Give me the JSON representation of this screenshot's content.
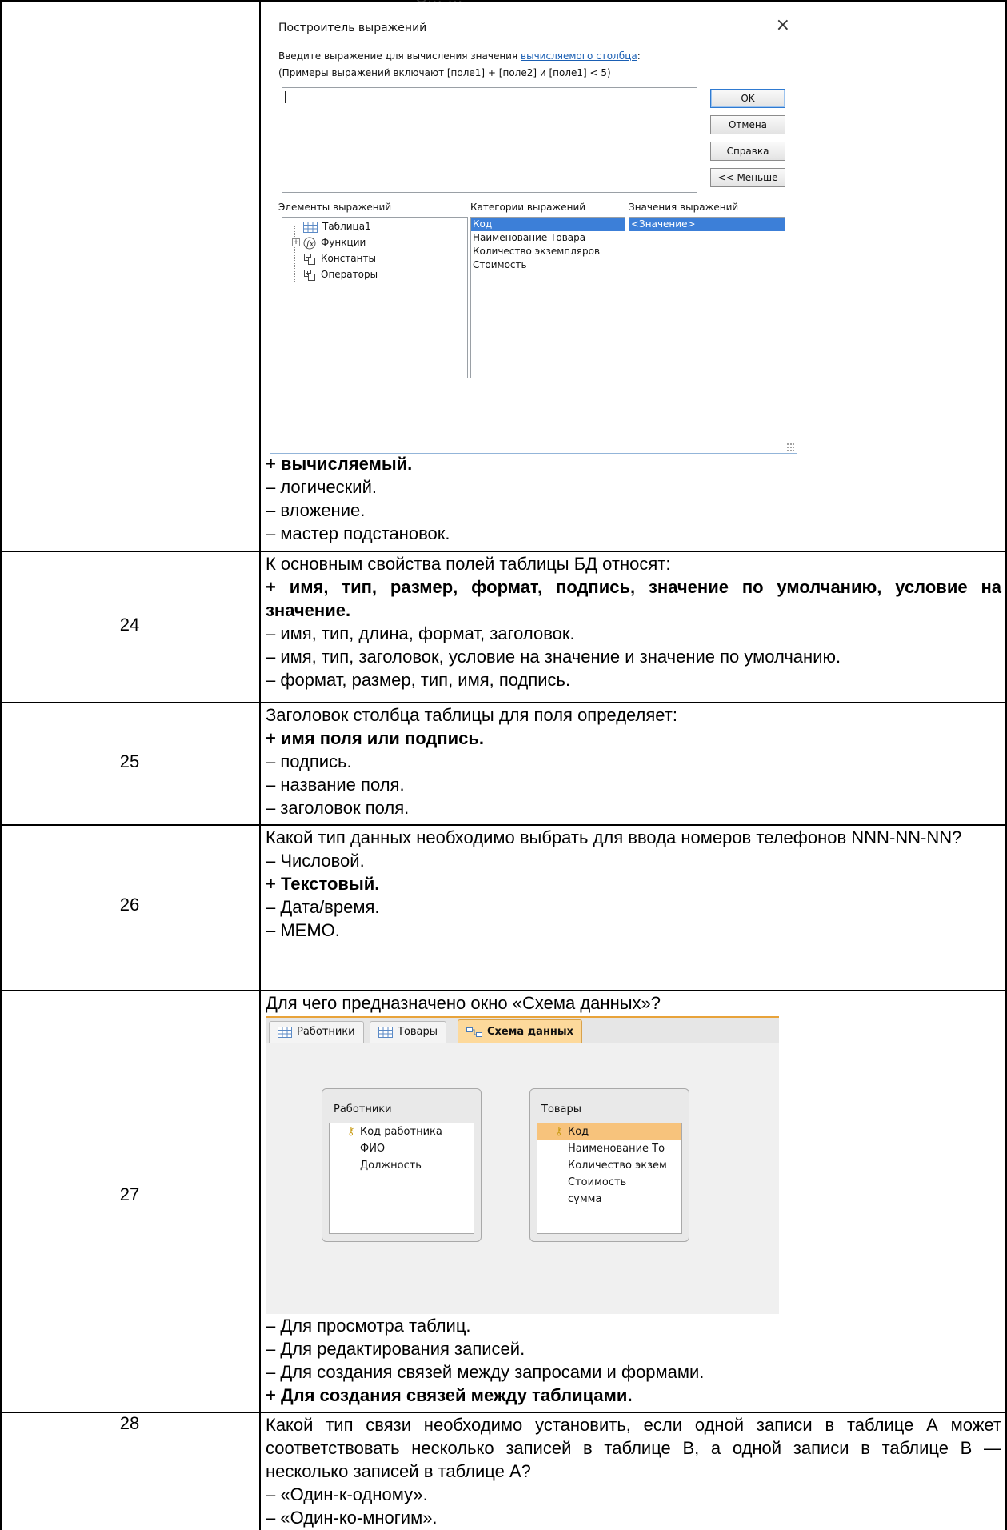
{
  "top_cut_text": "S…  …",
  "expression_builder": {
    "title": "Построитель выражений",
    "close": "×",
    "prompt_text": "Введите выражение для вычисления значения ",
    "prompt_link": "вычисляемого столбца",
    "prompt_colon": ":",
    "hint": "(Примеры выражений включают [поле1] + [поле2] и [поле1] < 5)",
    "buttons": {
      "ok": "OK",
      "cancel": "Отмена",
      "help": "Справка",
      "less": "<< Меньше"
    },
    "elements_label": "Элементы выражений",
    "categories_label": "Категории выражений",
    "values_label": "Значения выражений",
    "tree": [
      "Таблица1",
      "Функции",
      "Константы",
      "Операторы"
    ],
    "categories": [
      "Код",
      "Наименование Товара",
      "Количество экземпляров",
      "Стоимость"
    ],
    "values": [
      "<Значение>"
    ]
  },
  "q23": {
    "options": [
      "+ вычисляемый.",
      "– логический.",
      "– вложение.",
      "– мастер подстановок."
    ]
  },
  "q24": {
    "num": "24",
    "question": "К основным свойства полей таблицы БД относят:",
    "correct": "+ имя, тип, размер, формат, подпись, значение по умолчанию, условие на значение.",
    "options": [
      "– имя, тип, длина, формат, заголовок.",
      "– имя, тип, заголовок, условие на значение и значение по умолчанию.",
      "– формат, размер, тип, имя, подпись."
    ]
  },
  "q25": {
    "num": "25",
    "question": "Заголовок столбца таблицы для поля определяет:",
    "correct": "+ имя поля или подпись.",
    "options": [
      "– подпись.",
      "– название поля.",
      "– заголовок поля."
    ]
  },
  "q26": {
    "num": "26",
    "question": "Какой тип данных необходимо выбрать для ввода номеров телефонов NNN-NN-NN?",
    "opt1": "– Числовой.",
    "correct": "+ Текстовый.",
    "opt3": "– Дата/время.",
    "opt4": "– MEMO."
  },
  "q27": {
    "num": "27",
    "question": "Для чего предназначено окно «Схема данных»?",
    "options": [
      "– Для просмотра таблиц.",
      "– Для редактирования записей.",
      "– Для создания связей между запросами и формами."
    ],
    "correct": "+ Для создания связей между таблицами."
  },
  "schema": {
    "tabs": [
      "Работники",
      "Товары",
      "Схема данных"
    ],
    "tables": [
      {
        "name": "Работники",
        "fields": [
          "Код работника",
          "ФИО",
          "Должность"
        ]
      },
      {
        "name": "Товары",
        "fields": [
          "Код",
          "Наименование То",
          "Количество экзем",
          "Стоимость",
          "сумма"
        ]
      }
    ]
  },
  "q28": {
    "num": "28",
    "question": "Какой тип связи необходимо установить, если одной записи в таблице А может соответствовать несколько записей в таблице В, а одной записи в таблице В — несколько записей в таблице А?",
    "options": [
      "– «Один-к-одному».",
      "– «Один-ко-многим»."
    ]
  }
}
